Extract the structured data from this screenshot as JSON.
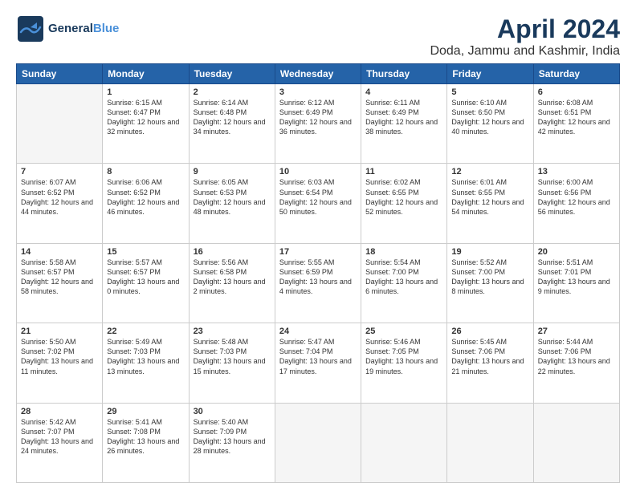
{
  "header": {
    "logo_line1": "General",
    "logo_line2": "Blue",
    "title": "April 2024",
    "subtitle": "Doda, Jammu and Kashmir, India"
  },
  "calendar": {
    "days_of_week": [
      "Sunday",
      "Monday",
      "Tuesday",
      "Wednesday",
      "Thursday",
      "Friday",
      "Saturday"
    ],
    "weeks": [
      [
        {
          "day": null,
          "content": null
        },
        {
          "day": "1",
          "sunrise": "6:15 AM",
          "sunset": "6:47 PM",
          "daylight": "12 hours and 32 minutes."
        },
        {
          "day": "2",
          "sunrise": "6:14 AM",
          "sunset": "6:48 PM",
          "daylight": "12 hours and 34 minutes."
        },
        {
          "day": "3",
          "sunrise": "6:12 AM",
          "sunset": "6:49 PM",
          "daylight": "12 hours and 36 minutes."
        },
        {
          "day": "4",
          "sunrise": "6:11 AM",
          "sunset": "6:49 PM",
          "daylight": "12 hours and 38 minutes."
        },
        {
          "day": "5",
          "sunrise": "6:10 AM",
          "sunset": "6:50 PM",
          "daylight": "12 hours and 40 minutes."
        },
        {
          "day": "6",
          "sunrise": "6:08 AM",
          "sunset": "6:51 PM",
          "daylight": "12 hours and 42 minutes."
        }
      ],
      [
        {
          "day": "7",
          "sunrise": "6:07 AM",
          "sunset": "6:52 PM",
          "daylight": "12 hours and 44 minutes."
        },
        {
          "day": "8",
          "sunrise": "6:06 AM",
          "sunset": "6:52 PM",
          "daylight": "12 hours and 46 minutes."
        },
        {
          "day": "9",
          "sunrise": "6:05 AM",
          "sunset": "6:53 PM",
          "daylight": "12 hours and 48 minutes."
        },
        {
          "day": "10",
          "sunrise": "6:03 AM",
          "sunset": "6:54 PM",
          "daylight": "12 hours and 50 minutes."
        },
        {
          "day": "11",
          "sunrise": "6:02 AM",
          "sunset": "6:55 PM",
          "daylight": "12 hours and 52 minutes."
        },
        {
          "day": "12",
          "sunrise": "6:01 AM",
          "sunset": "6:55 PM",
          "daylight": "12 hours and 54 minutes."
        },
        {
          "day": "13",
          "sunrise": "6:00 AM",
          "sunset": "6:56 PM",
          "daylight": "12 hours and 56 minutes."
        }
      ],
      [
        {
          "day": "14",
          "sunrise": "5:58 AM",
          "sunset": "6:57 PM",
          "daylight": "12 hours and 58 minutes."
        },
        {
          "day": "15",
          "sunrise": "5:57 AM",
          "sunset": "6:57 PM",
          "daylight": "13 hours and 0 minutes."
        },
        {
          "day": "16",
          "sunrise": "5:56 AM",
          "sunset": "6:58 PM",
          "daylight": "13 hours and 2 minutes."
        },
        {
          "day": "17",
          "sunrise": "5:55 AM",
          "sunset": "6:59 PM",
          "daylight": "13 hours and 4 minutes."
        },
        {
          "day": "18",
          "sunrise": "5:54 AM",
          "sunset": "7:00 PM",
          "daylight": "13 hours and 6 minutes."
        },
        {
          "day": "19",
          "sunrise": "5:52 AM",
          "sunset": "7:00 PM",
          "daylight": "13 hours and 8 minutes."
        },
        {
          "day": "20",
          "sunrise": "5:51 AM",
          "sunset": "7:01 PM",
          "daylight": "13 hours and 9 minutes."
        }
      ],
      [
        {
          "day": "21",
          "sunrise": "5:50 AM",
          "sunset": "7:02 PM",
          "daylight": "13 hours and 11 minutes."
        },
        {
          "day": "22",
          "sunrise": "5:49 AM",
          "sunset": "7:03 PM",
          "daylight": "13 hours and 13 minutes."
        },
        {
          "day": "23",
          "sunrise": "5:48 AM",
          "sunset": "7:03 PM",
          "daylight": "13 hours and 15 minutes."
        },
        {
          "day": "24",
          "sunrise": "5:47 AM",
          "sunset": "7:04 PM",
          "daylight": "13 hours and 17 minutes."
        },
        {
          "day": "25",
          "sunrise": "5:46 AM",
          "sunset": "7:05 PM",
          "daylight": "13 hours and 19 minutes."
        },
        {
          "day": "26",
          "sunrise": "5:45 AM",
          "sunset": "7:06 PM",
          "daylight": "13 hours and 21 minutes."
        },
        {
          "day": "27",
          "sunrise": "5:44 AM",
          "sunset": "7:06 PM",
          "daylight": "13 hours and 22 minutes."
        }
      ],
      [
        {
          "day": "28",
          "sunrise": "5:42 AM",
          "sunset": "7:07 PM",
          "daylight": "13 hours and 24 minutes."
        },
        {
          "day": "29",
          "sunrise": "5:41 AM",
          "sunset": "7:08 PM",
          "daylight": "13 hours and 26 minutes."
        },
        {
          "day": "30",
          "sunrise": "5:40 AM",
          "sunset": "7:09 PM",
          "daylight": "13 hours and 28 minutes."
        },
        {
          "day": null,
          "content": null
        },
        {
          "day": null,
          "content": null
        },
        {
          "day": null,
          "content": null
        },
        {
          "day": null,
          "content": null
        }
      ]
    ]
  }
}
